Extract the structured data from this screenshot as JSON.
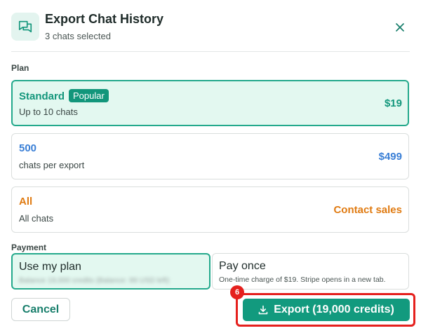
{
  "dialog": {
    "title": "Export Chat History",
    "subtitle": "3 chats selected"
  },
  "plan_section": {
    "label": "Plan",
    "options": [
      {
        "name": "Standard",
        "badge": "Popular",
        "description": "Up to 10 chats",
        "price": "$19",
        "color": "#12967b",
        "selected": true
      },
      {
        "name": "500",
        "description": "chats per export",
        "price": "$499",
        "color": "#3a7fd6",
        "selected": false
      },
      {
        "name": "All",
        "description": "All chats",
        "price": "Contact sales",
        "color": "#e07b12",
        "selected": false
      }
    ]
  },
  "payment_section": {
    "label": "Payment",
    "options": [
      {
        "title": "Use my plan",
        "description": "Balance 19,000 credits (Balance: 99 USD left)",
        "selected": true
      },
      {
        "title": "Pay once",
        "description": "One-time charge of $19. Stripe opens in a new tab.",
        "selected": false
      }
    ]
  },
  "actions": {
    "cancel_label": "Cancel",
    "export_label": "Export (19,000 credits)",
    "step_number": "6"
  },
  "colors": {
    "accent": "#12967b",
    "highlight": "#e5201d"
  },
  "icons": {
    "header": "chat-bubbles-icon",
    "close": "close-icon",
    "export": "download-icon"
  }
}
